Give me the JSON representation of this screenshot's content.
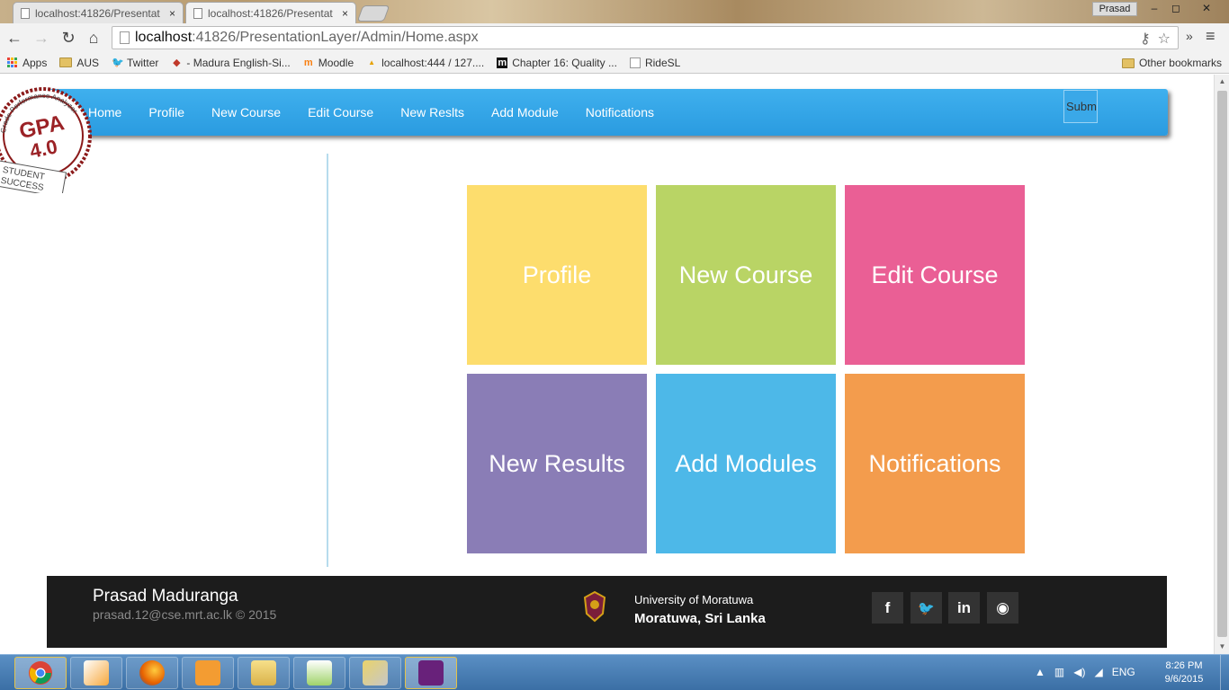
{
  "browser": {
    "tabs": [
      {
        "title": "localhost:41826/Presentat",
        "close": "×"
      },
      {
        "title": "localhost:41826/Presentat",
        "close": "×"
      }
    ],
    "profile_name": "Prasad",
    "window_controls": {
      "minimize": "–",
      "maximize": "◻",
      "close": "✕"
    },
    "nav": {
      "back": "←",
      "forward": "→",
      "reload": "↻",
      "home": "⌂"
    },
    "url_host": "localhost",
    "url_path": ":41826/PresentationLayer/Admin/Home.aspx",
    "omni_key_icon": "⚷",
    "omni_star_icon": "☆",
    "extensions_chevron": "»",
    "menu_icon": "≡",
    "bookmarks": [
      {
        "label": "Apps",
        "icon": "apps-icon"
      },
      {
        "label": "AUS",
        "icon": "folder-icon"
      },
      {
        "label": "Twitter",
        "icon": "twitter-icon"
      },
      {
        "label": "- Madura English-Si...",
        "icon": "madura-icon"
      },
      {
        "label": "Moodle",
        "icon": "moodle-icon"
      },
      {
        "label": "localhost:444 / 127....",
        "icon": "pma-icon"
      },
      {
        "label": "Chapter 16: Quality ...",
        "icon": "medium-icon"
      },
      {
        "label": "RideSL",
        "icon": "page-icon"
      }
    ],
    "other_bookmarks": "Other bookmarks"
  },
  "navbar": {
    "links": [
      "Home",
      "Profile",
      "New Course",
      "Edit Course",
      "New Reslts",
      "Add Module",
      "Notifications"
    ],
    "submit_label": "Submit"
  },
  "logo": {
    "text_arc": "Grade Performance Analyzer",
    "main": "GPA",
    "version": "4.0",
    "banner_line1": "STUDENT",
    "banner_line2": "SUCCESS"
  },
  "tiles": [
    {
      "label": "Profile",
      "color": "#fddd6d"
    },
    {
      "label": "New Course",
      "color": "#b9d465"
    },
    {
      "label": "Edit Course",
      "color": "#ea5f95"
    },
    {
      "label": "New Results",
      "color": "#8a7db6"
    },
    {
      "label": "Add Modules",
      "color": "#4db8e8"
    },
    {
      "label": "Notifications",
      "color": "#f39c4d"
    }
  ],
  "footer": {
    "author_name": "Prasad Maduranga",
    "author_email": "prasad.12@cse.mrt.ac.lk © 2015",
    "university": "University of Moratuwa",
    "location": "Moratuwa, Sri Lanka",
    "social": [
      {
        "name": "facebook-icon",
        "glyph": "f"
      },
      {
        "name": "twitter-icon",
        "glyph": "🐦"
      },
      {
        "name": "linkedin-icon",
        "glyph": "in"
      },
      {
        "name": "github-icon",
        "glyph": "◉"
      }
    ]
  },
  "taskbar": {
    "apps": [
      "chrome-icon",
      "sublime-icon",
      "firefox-icon",
      "media-player-icon",
      "file-explorer-icon",
      "notepad-plus-icon",
      "snipping-tool-icon",
      "visual-studio-icon"
    ],
    "language": "ENG",
    "time": "8:26 PM",
    "date": "9/6/2015"
  },
  "colors": {
    "navbar": "#2fa3e6",
    "footer": "#1c1c1c",
    "divider": "#b7dced"
  }
}
